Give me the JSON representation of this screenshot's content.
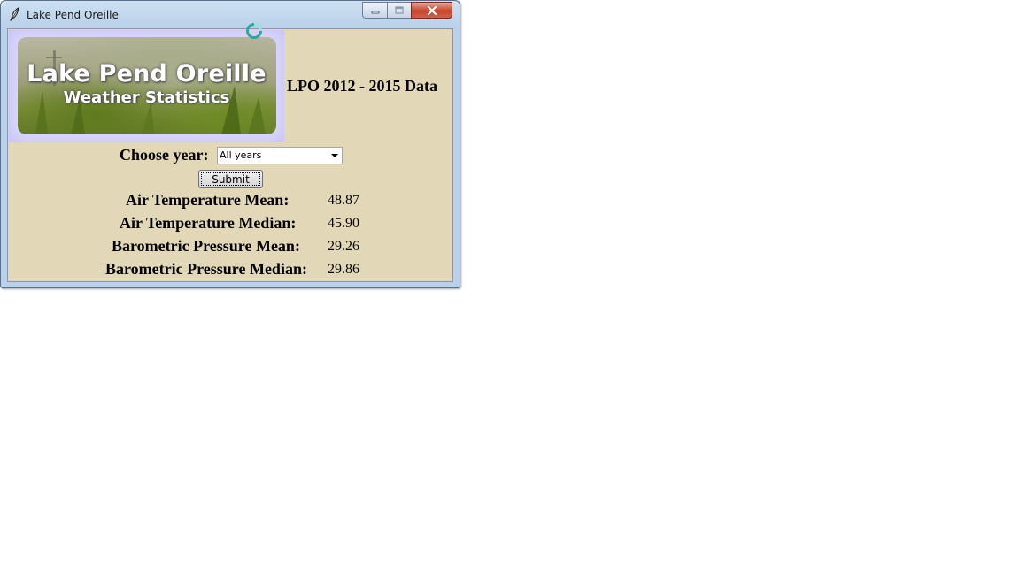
{
  "window": {
    "title": "Lake Pend Oreille",
    "app_icon": "feather-icon"
  },
  "caption_buttons": {
    "minimize_icon": "minimize-icon",
    "maximize_icon": "maximize-icon",
    "close_icon": "close-icon"
  },
  "banner": {
    "title": "Lake Pend Oreille",
    "subtitle": "Weather Statistics"
  },
  "heading": "LPO 2012 - 2015 Data",
  "year_picker": {
    "label": "Choose year:",
    "selected": "All years"
  },
  "submit_label": "Submit",
  "stats": [
    {
      "label": "Air Temperature Mean:",
      "value": "48.87"
    },
    {
      "label": "Air Temperature Median:",
      "value": "45.90"
    },
    {
      "label": "Barometric Pressure Mean:",
      "value": "29.26"
    },
    {
      "label": "Barometric Pressure Median:",
      "value": "29.86"
    }
  ],
  "colors": {
    "window_background": "#e2d8b8",
    "banner_frame": "#c9c6f5",
    "close_button": "#c7442c"
  }
}
